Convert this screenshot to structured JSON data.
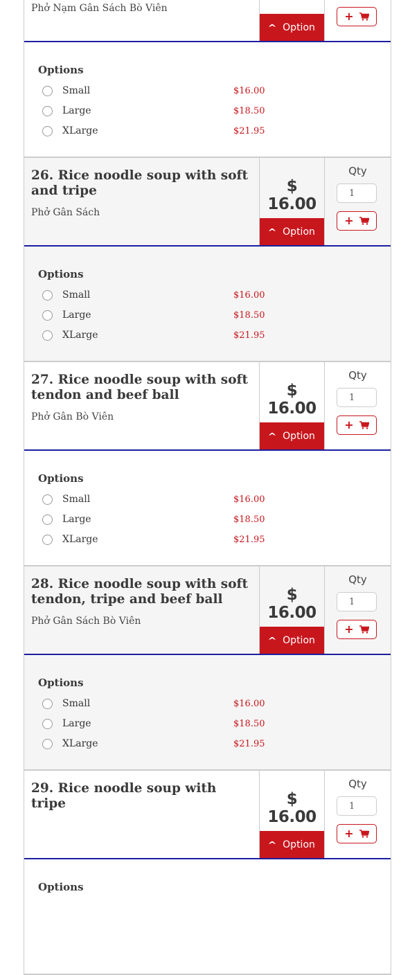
{
  "options_label": "Options",
  "qty_label": "Qty",
  "option_button_label": "Option",
  "option_chevron": "^",
  "cart_plus": "+",
  "colors": {
    "accent": "#c8161d",
    "divider": "#1a1f9e",
    "alt_background": "#f5f5f5"
  },
  "icons": {
    "option_toggle": "chevron-up-icon",
    "add": "plus-icon",
    "cart": "cart-icon",
    "radio": "radio-circle"
  },
  "items": [
    {
      "title": "",
      "subtitle": "Phở Nạm Gân Sách Bò Viên",
      "price": "",
      "qty": "",
      "options": [
        {
          "name": "Small",
          "price": "$16.00"
        },
        {
          "name": "Large",
          "price": "$18.50"
        },
        {
          "name": "XLarge",
          "price": "$21.95"
        }
      ]
    },
    {
      "title": "26. Rice noodle soup with soft and tripe",
      "subtitle": "Phở Gân Sách",
      "price": "$ 16.00",
      "qty": "1",
      "options": [
        {
          "name": "Small",
          "price": "$16.00"
        },
        {
          "name": "Large",
          "price": "$18.50"
        },
        {
          "name": "XLarge",
          "price": "$21.95"
        }
      ]
    },
    {
      "title": "27. Rice noodle soup with soft tendon and beef ball",
      "subtitle": "Phở Gân Bò Viên",
      "price": "$ 16.00",
      "qty": "1",
      "options": [
        {
          "name": "Small",
          "price": "$16.00"
        },
        {
          "name": "Large",
          "price": "$18.50"
        },
        {
          "name": "XLarge",
          "price": "$21.95"
        }
      ]
    },
    {
      "title": "28. Rice noodle soup with soft tendon, tripe and beef ball",
      "subtitle": "Phở Gân Sách Bò Viên",
      "price": "$ 16.00",
      "qty": "1",
      "options": [
        {
          "name": "Small",
          "price": "$16.00"
        },
        {
          "name": "Large",
          "price": "$18.50"
        },
        {
          "name": "XLarge",
          "price": "$21.95"
        }
      ]
    },
    {
      "title": "29. Rice noodle soup with tripe",
      "subtitle": "",
      "price": "$ 16.00",
      "qty": "1",
      "options": []
    }
  ]
}
